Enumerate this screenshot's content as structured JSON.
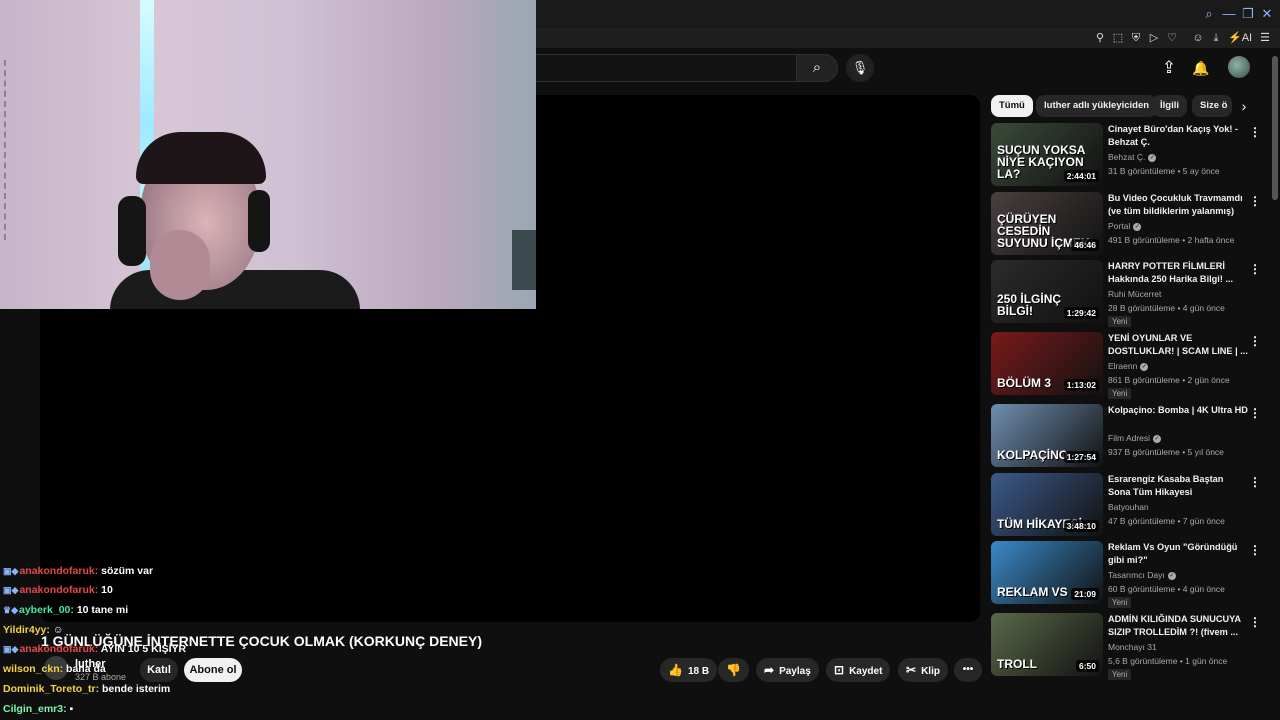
{
  "browser": {
    "icons": [
      "search-icon",
      "minimize-icon",
      "restore-icon",
      "close-icon"
    ],
    "toolbar_icons": [
      "pin-icon",
      "crop-icon",
      "shield-icon",
      "play-icon",
      "heart-icon",
      "account-icon",
      "download-icon",
      "ai-icon",
      "menu-icon"
    ],
    "ai_label": "AI"
  },
  "header": {
    "search_placeholder": "",
    "search_icon": "⌕",
    "mic_icon": "🎙",
    "upload_icon": "⇪",
    "bell_icon": "🔔"
  },
  "video": {
    "title": "1 GÜNLÜĞÜNE İNTERNETTE ÇOCUK OLMAK (KORKUNÇ DENEY)",
    "overlay_text": "AYIN 10 5 KİŞİ?R",
    "channel": "luther",
    "subscribers": "327 B abone",
    "join_label": "Katıl",
    "subscribe_label": "Abone ol",
    "likes": "18 B",
    "share_label": "Paylaş",
    "save_label": "Kaydet",
    "clip_label": "Klip",
    "more_icon": "•••"
  },
  "chat": [
    {
      "badges": "▣◆",
      "user": "anakondofaruk",
      "color": "red",
      "text": "sözüm var"
    },
    {
      "badges": "▣◆",
      "user": "anakondofaruk",
      "color": "red",
      "text": "10"
    },
    {
      "badges": "♛◆",
      "user": "ayberk_00",
      "color": "green",
      "text": "10 tane mi"
    },
    {
      "badges": "",
      "user": "Yildir4yy",
      "color": "yellow",
      "text": "☺"
    },
    {
      "badges": "▣◆",
      "user": "anakondofaruk",
      "color": "red",
      "text": "AYIN 10 5 KİŞİYR"
    },
    {
      "badges": "",
      "user": "wilson_ckn",
      "color": "yellow",
      "text": "bana da"
    },
    {
      "badges": "",
      "user": "Dominik_Toreto_tr",
      "color": "yellow",
      "text": "bende isterim"
    },
    {
      "badges": "",
      "user": "Cilgin_emr3",
      "color": "mint",
      "text": "▪"
    }
  ],
  "sidebar": {
    "chips": [
      "Tümü",
      "luther adlı yükleyiciden",
      "İlgili",
      "Size ö"
    ],
    "recommendations": [
      {
        "title": "Cinayet Büro'dan Kaçış Yok! - Behzat Ç.",
        "channel": "Behzat Ç.",
        "verified": true,
        "meta": "31 B görüntüleme • 5 ay önce",
        "duration": "2:44:01",
        "new": "",
        "thumb_text": "SUÇUN YOKSA NİYE KAÇIYON LA?",
        "thumb_color": "#3b4a3a"
      },
      {
        "title": "Bu Video Çocukluk Travmamdı (ve tüm bildiklerim yalanmış)",
        "channel": "Portal",
        "verified": true,
        "meta": "491 B görüntüleme • 2 hafta önce",
        "duration": "46:46",
        "new": "",
        "thumb_text": "ÇÜRÜYEN CESEDİN SUYUNU İÇMEK",
        "thumb_color": "#4a4040"
      },
      {
        "title": "HARRY POTTER FİLMLERİ Hakkında 250 Harika Bilgi! ...",
        "channel": "Ruhi Mücerret",
        "verified": false,
        "meta": "28 B görüntüleme • 4 gün önce",
        "duration": "1:29:42",
        "new": "Yeni",
        "thumb_text": "250 İLGİNÇ BİLGİ!",
        "thumb_color": "#2b2b2b"
      },
      {
        "title": "YENİ OYUNLAR VE DOSTLUKLAR! | SCAM LINE | ...",
        "channel": "Elraenn",
        "verified": true,
        "meta": "861 B görüntüleme • 2 gün önce",
        "duration": "1:13:02",
        "new": "Yeni",
        "thumb_text": "BÖLÜM 3",
        "thumb_color": "#7a1a1a"
      },
      {
        "title": "Kolpaçino: Bomba | 4K Ultra HD",
        "channel": "Film Adresi",
        "verified": true,
        "meta": "937 B görüntüleme • 5 yıl önce",
        "duration": "1:27:54",
        "new": "",
        "thumb_text": "KOLPAÇİNO",
        "thumb_color": "#6f8fb0"
      },
      {
        "title": "Esrarengiz Kasaba Baştan Sona Tüm Hikayesi",
        "channel": "Batyouhan",
        "verified": false,
        "meta": "47 B görüntüleme • 7 gün önce",
        "duration": "3:48:10",
        "new": "",
        "thumb_text": "TÜM HİKAYESİ",
        "thumb_color": "#3c5a8a"
      },
      {
        "title": "Reklam Vs Oyun \"Göründüğü gibi mi?\"",
        "channel": "Tasarımcı Dayı",
        "verified": true,
        "meta": "60 B görüntüleme • 4 gün önce",
        "duration": "21:09",
        "new": "Yeni",
        "thumb_text": "REKLAM VS",
        "thumb_color": "#3a8ac8"
      },
      {
        "title": "ADMİN KILIĞINDA SUNUCUYA SIZIP TROLLEDİM ?! (fivem ...",
        "channel": "Monchayı 31",
        "verified": false,
        "meta": "5,6 B görüntüleme • 1 gün önce",
        "duration": "6:50",
        "new": "Yeni",
        "thumb_text": "TROLL",
        "thumb_color": "#5a6a4a"
      }
    ]
  }
}
